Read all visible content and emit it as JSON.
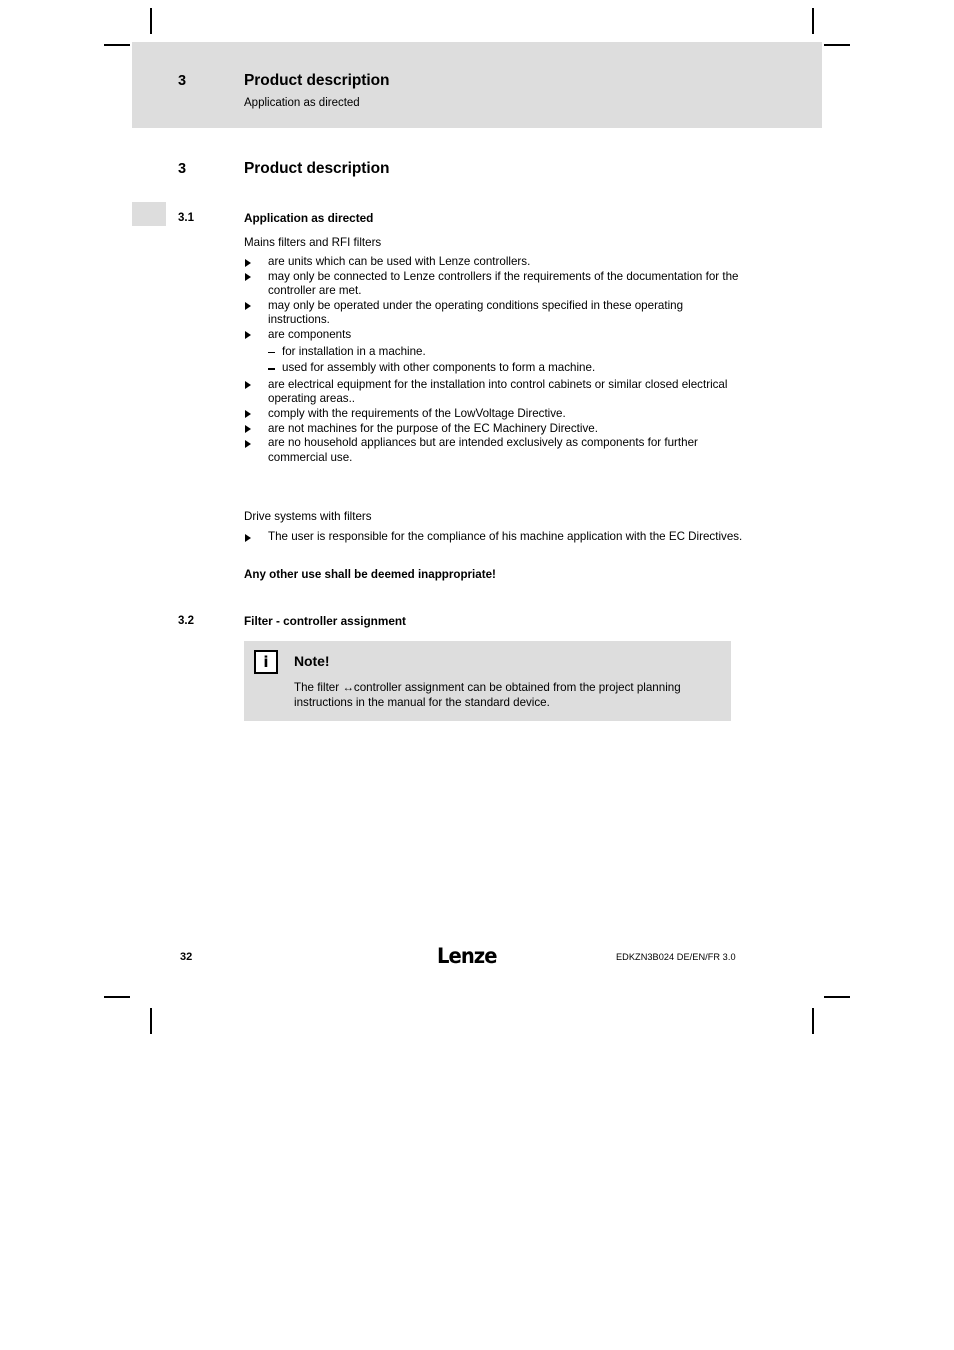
{
  "header": {
    "chapter_number": "3",
    "title": "Product description",
    "subtitle": "Application as directed"
  },
  "chapter": {
    "number": "3",
    "title": "Product description"
  },
  "sections": {
    "s31": {
      "number": "3.1",
      "title": "Application as directed",
      "lead": "Mains filters and RFI filters",
      "bullets": [
        {
          "text": "are units which can be used with Lenze controllers."
        },
        {
          "text": "may only be connected to Lenze controllers if the requirements of the documentation for the controller are met."
        },
        {
          "text": "may only be operated under the operating conditions specified in these operating instructions."
        },
        {
          "text": "are components",
          "sub": [
            "for installation in a machine.",
            "used for assembly with other components to form a machine."
          ]
        },
        {
          "text": "are electrical equipment for the installation into control cabinets or similar closed electrical operating areas.."
        },
        {
          "text": "comply with the requirements of the LowVoltage Directive."
        },
        {
          "text": "are not machines for the purpose of the EC Machinery Directive."
        },
        {
          "text": "are no household appliances but are intended exclusively as components for further commercial use."
        }
      ],
      "lead2": "Drive systems with filters",
      "bullets2": [
        {
          "text": "The user is responsible for the compliance of his machine application with the EC Directives."
        }
      ],
      "closing_bold": "Any other use shall be deemed inappropriate!"
    },
    "s32": {
      "number": "3.2",
      "title": "Filter - controller assignment",
      "note": {
        "icon": "info-icon",
        "icon_glyph": "i",
        "title": "Note!",
        "body": "The filter ↔controller assignment can be obtained from the project planning instructions in the manual for the standard device."
      }
    }
  },
  "footer": {
    "page_number": "32",
    "logo": "Lenze",
    "document_code": "EDKZN3B024 DE/EN/FR 3.0"
  },
  "colors": {
    "band_gray": "#dddddd",
    "text": "#000000",
    "page": "#ffffff"
  }
}
